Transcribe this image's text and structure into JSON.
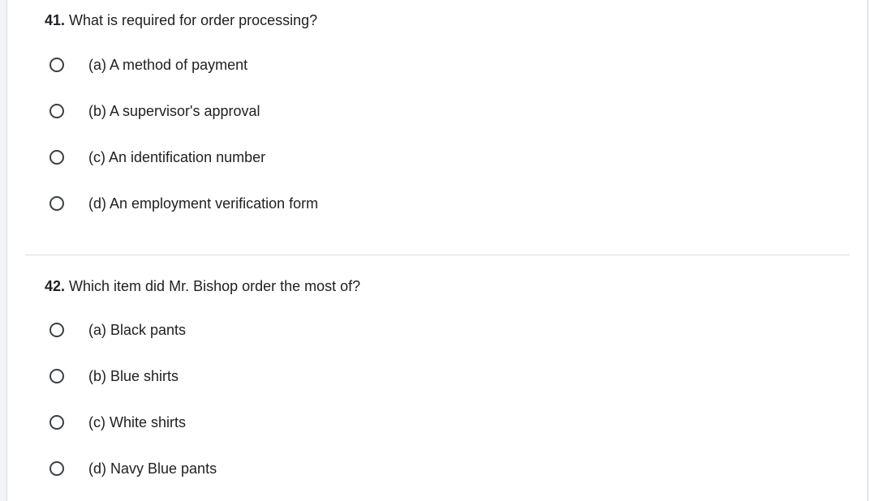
{
  "questions": [
    {
      "number": "41.",
      "text": " What is required for order processing?",
      "options": [
        "(a) A method of payment",
        "(b) A supervisor's approval",
        "(c) An identification number",
        "(d) An employment verification form"
      ]
    },
    {
      "number": "42.",
      "text": " Which item did Mr. Bishop order the most of?",
      "options": [
        "(a) Black pants",
        "(b) Blue shirts",
        "(c) White shirts",
        "(d) Navy Blue pants"
      ]
    }
  ],
  "icons": {
    "option": "radio-unchecked-icon"
  }
}
